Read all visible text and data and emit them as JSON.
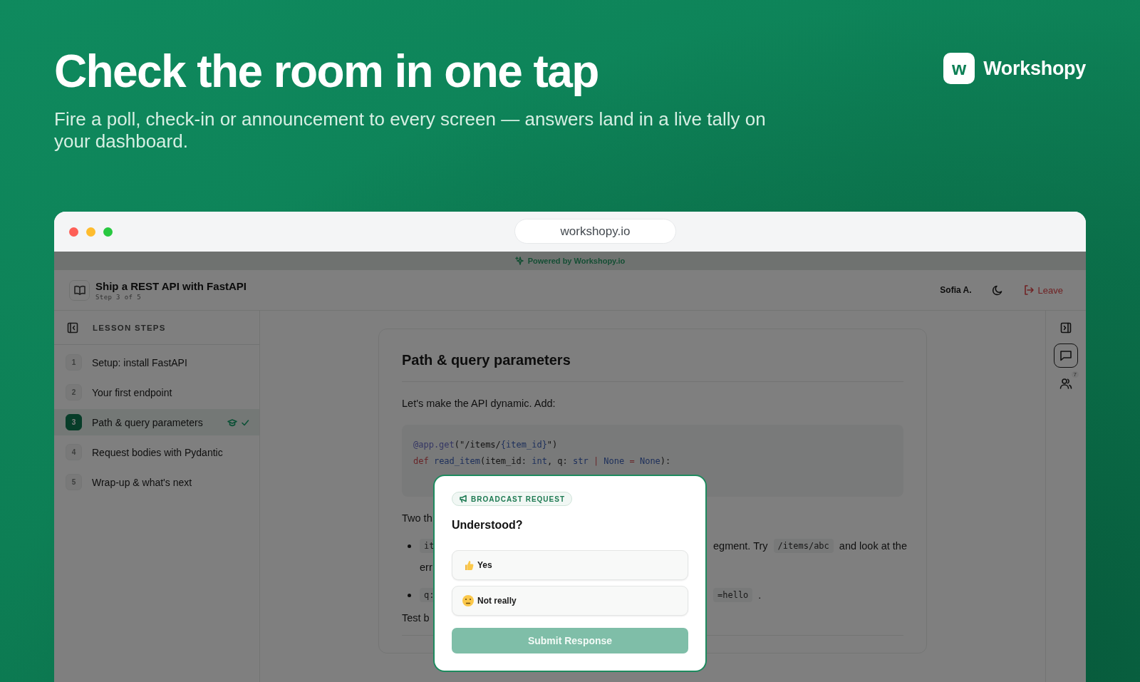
{
  "hero": {
    "title": "Check the room in one tap",
    "subtitle": "Fire a poll, check-in or announcement to every screen — answers land in a live tally on your dashboard."
  },
  "brand": {
    "logo_letter": "w",
    "name": "Workshopy"
  },
  "browser": {
    "url": "workshopy.io"
  },
  "banner": {
    "text": "Powered by Workshopy.io"
  },
  "header": {
    "title": "Ship a REST API with FastAPI",
    "step": "Step 3 of 5",
    "user": "Sofia A.",
    "leave": "Leave"
  },
  "sidebar": {
    "heading": "LESSON STEPS",
    "items": [
      {
        "number": "1",
        "label": "Setup: install FastAPI",
        "selected": false,
        "instructor_here": false,
        "completed": false
      },
      {
        "number": "2",
        "label": "Your first endpoint",
        "selected": false,
        "instructor_here": false,
        "completed": false
      },
      {
        "number": "3",
        "label": "Path & query parameters",
        "selected": true,
        "instructor_here": true,
        "completed": true
      },
      {
        "number": "4",
        "label": "Request bodies with Pydantic",
        "selected": false,
        "instructor_here": false,
        "completed": false
      },
      {
        "number": "5",
        "label": "Wrap-up & what's next",
        "selected": false,
        "instructor_here": false,
        "completed": false
      }
    ]
  },
  "lesson": {
    "title": "Path & query parameters",
    "intro": "Let's make the API dynamic. Add:",
    "code": [
      [
        {
          "kind": "decorator",
          "text": "@app.get"
        },
        {
          "kind": "plain",
          "text": "(\"/items/"
        },
        {
          "kind": "name",
          "text": "{item_id}"
        },
        {
          "kind": "plain",
          "text": "\")"
        }
      ],
      [
        {
          "kind": "keyword",
          "text": "def"
        },
        {
          "kind": "name",
          "text": " read_item"
        },
        {
          "kind": "plain",
          "text": "(item_id: "
        },
        {
          "kind": "name",
          "text": "int"
        },
        {
          "kind": "plain",
          "text": ", q: "
        },
        {
          "kind": "name",
          "text": "str"
        },
        {
          "kind": "keyword",
          "text": " |"
        },
        {
          "kind": "name",
          "text": " None"
        },
        {
          "kind": "keyword",
          "text": " ="
        },
        {
          "kind": "name",
          "text": " None"
        },
        {
          "kind": "plain",
          "text": "):"
        }
      ]
    ],
    "paragraph": "Two th",
    "bullets": [
      {
        "lines": [
          {
            "before": [
              {
                "kind": "code",
                "text": "it"
              }
            ],
            "after": [
              {
                "kind": "text",
                "text": "egment. Try"
              },
              {
                "kind": "code",
                "text": "/items/abc"
              },
              {
                "kind": "text",
                "text": "and look at the"
              }
            ]
          },
          {
            "before": [
              {
                "kind": "text",
                "text": "err"
              }
            ]
          }
        ]
      },
      {
        "lines": [
          {
            "before": [
              {
                "kind": "code",
                "text": "q:"
              }
            ],
            "after": [
              {
                "kind": "code",
                "text": "=hello"
              },
              {
                "kind": "text",
                "text": "."
              }
            ]
          }
        ]
      }
    ],
    "closing": "Test b"
  },
  "rail": {
    "people_count": "7"
  },
  "modal": {
    "badge": "BROADCAST REQUEST",
    "question": "Understood?",
    "options": [
      {
        "label": "Yes",
        "selected": false
      },
      {
        "label": "Not really",
        "selected": false
      }
    ],
    "submit": {
      "label": "Submit Response",
      "disabled": true
    }
  }
}
